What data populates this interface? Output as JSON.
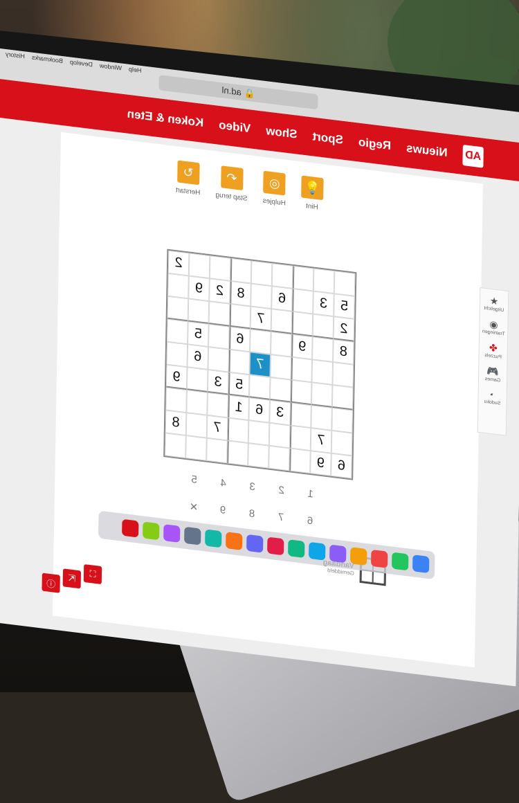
{
  "browser": {
    "url": "🔒 ad.nl",
    "menu": [
      "Help",
      "Window",
      "Develop",
      "Bookmarks",
      "History"
    ]
  },
  "site_nav": {
    "logo": "AD",
    "items": [
      "Nieuws",
      "Regio",
      "Sport",
      "Show",
      "Video",
      "Koken & Eten"
    ]
  },
  "toolbar": {
    "tools": [
      {
        "label": "Hint",
        "icon": "lightbulb-icon",
        "glyph": "💡"
      },
      {
        "label": "Hulpjes",
        "icon": "eye-slash-icon",
        "glyph": "◎"
      },
      {
        "label": "Stap terug",
        "icon": "undo-icon",
        "glyph": "↶"
      },
      {
        "label": "Herstart",
        "icon": "restart-icon",
        "glyph": "↻"
      }
    ]
  },
  "sidebar": {
    "items": [
      {
        "label": "Uitgelicht",
        "glyph": "★"
      },
      {
        "label": "Trainingen",
        "glyph": "◉"
      },
      {
        "label": "Puzzels",
        "glyph": "✤",
        "active": true
      },
      {
        "label": "Games",
        "glyph": "🎮"
      },
      {
        "label": "Sudoku",
        "glyph": "◔"
      }
    ]
  },
  "sudoku": {
    "rows": [
      [
        "",
        "",
        "",
        "",
        "",
        "",
        "",
        "",
        "2"
      ],
      [
        "5",
        "3",
        "",
        "6",
        "",
        "8",
        "2",
        "9",
        ""
      ],
      [
        "2",
        "",
        "",
        "",
        "7",
        "",
        "",
        "",
        ""
      ],
      [
        "8",
        "",
        "9",
        "",
        "",
        "6",
        "",
        "5",
        ""
      ],
      [
        "",
        "",
        "",
        "",
        "7",
        "",
        "",
        "6",
        ""
      ],
      [
        "",
        "",
        "",
        "",
        "",
        "5",
        "3",
        "",
        "9"
      ],
      [
        "",
        "",
        "",
        "3",
        "6",
        "1",
        "",
        "",
        ""
      ],
      [
        "",
        "7",
        "",
        "",
        "",
        "",
        "7",
        "",
        "8"
      ],
      [
        "",
        "",
        "3",
        "",
        "",
        "",
        "",
        "",
        ""
      ]
    ],
    "bottom_row": [
      "6",
      "9",
      "",
      "",
      "",
      "",
      "",
      "",
      ""
    ],
    "selected": {
      "row": 4,
      "col": 4
    }
  },
  "numpad": [
    "1",
    "2",
    "3",
    "4",
    "5",
    "6",
    "7",
    "8",
    "9",
    "✕"
  ],
  "daily": {
    "title": "Vandaag",
    "subtitle": "Gemiddeld"
  },
  "footer_text": "Sudoku. de dagelijkse puzzel Vandaag",
  "colors": {
    "brand_red": "#d7101a",
    "accent_orange": "#f0a020",
    "selected_cell": "#1e90c8"
  }
}
